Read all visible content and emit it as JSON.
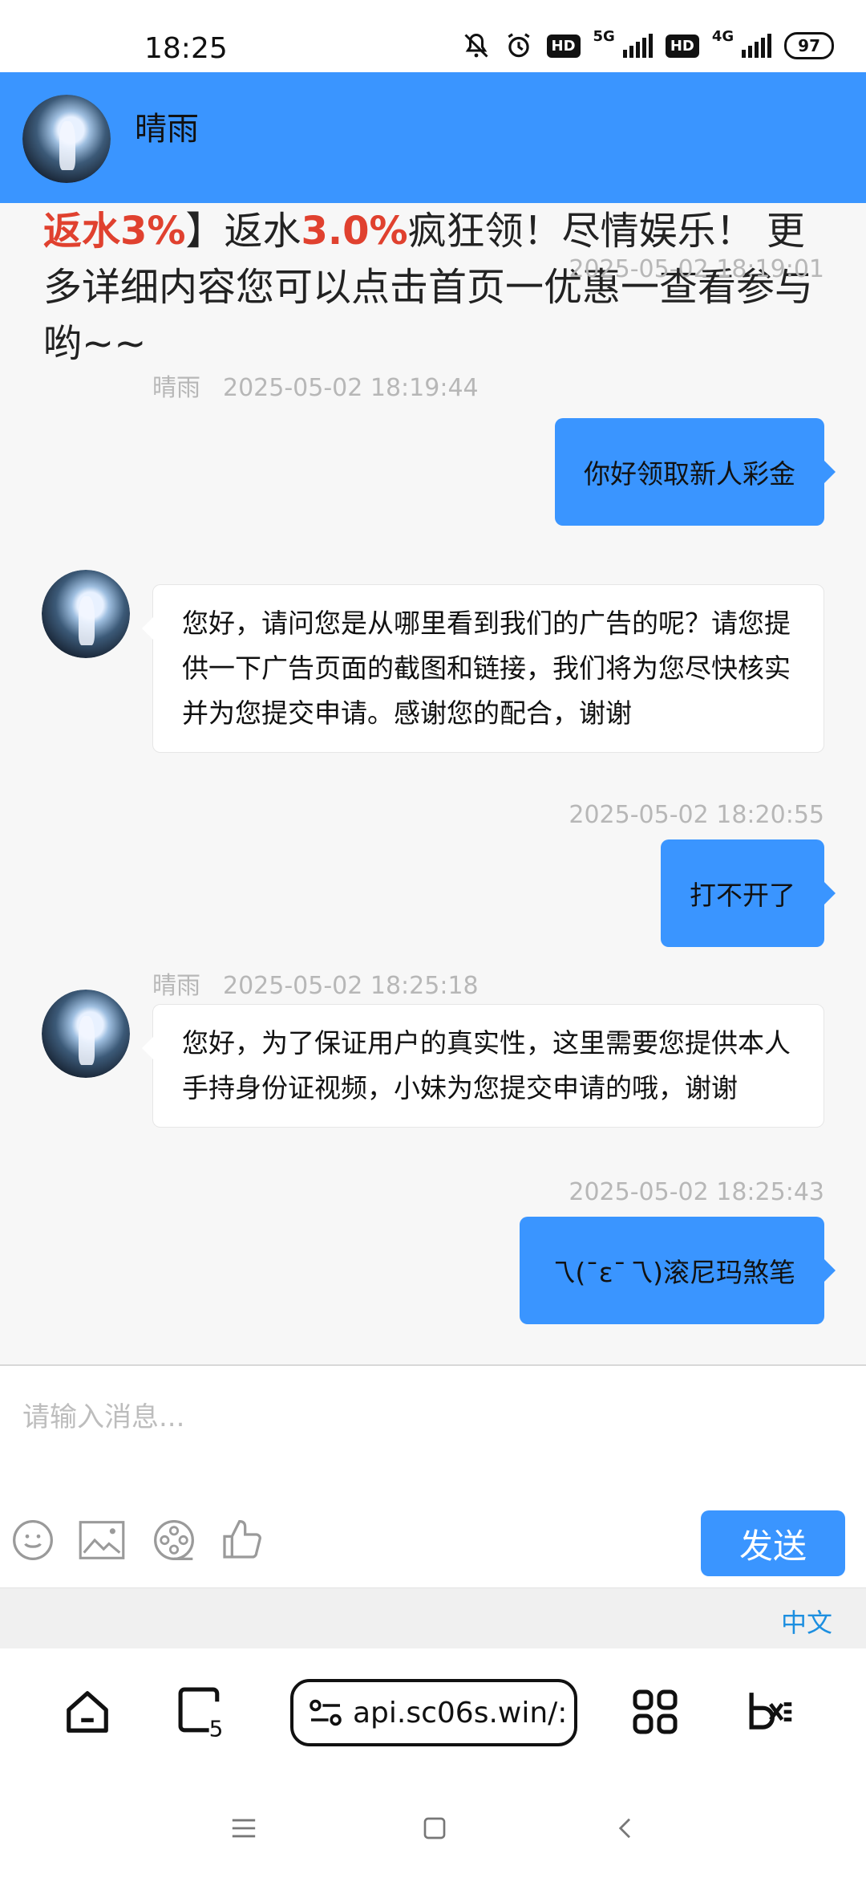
{
  "status": {
    "time": "18:25",
    "hd1": "HD",
    "net1": "5G",
    "hd2": "HD",
    "net2": "4G",
    "battery": "97"
  },
  "header": {
    "title": "晴雨"
  },
  "chat": {
    "prev_text": {
      "red1": "返水3%",
      "plain1": "】返水",
      "red2": "3.0%",
      "plain2": "疯狂领！尽情娱乐！ 更多详细内容您可以点击首页一优惠一查看参与哟~~"
    },
    "messages": [
      {
        "side": "out",
        "time": "2025-05-02 18:19:01",
        "text": "你好领取新人彩金"
      },
      {
        "side": "in",
        "sender": "晴雨",
        "time": "2025-05-02 18:19:44",
        "text": "您好，请问您是从哪里看到我们的广告的呢？请您提供一下广告页面的截图和链接，我们将为您尽快核实并为您提交申请。感谢您的配合，谢谢"
      },
      {
        "side": "out",
        "time": "2025-05-02 18:20:55",
        "text": "打不开了"
      },
      {
        "side": "in",
        "sender": "晴雨",
        "time": "2025-05-02 18:25:18",
        "text": "您好，为了保证用户的真实性，这里需要您提供本人手持身份证视频，小妹为您提交申请的哦，谢谢"
      },
      {
        "side": "out",
        "time": "2025-05-02 18:25:43",
        "text": "乁(ˉεˉ乁)滚尼玛煞笔"
      }
    ]
  },
  "input": {
    "placeholder": "请输入消息...",
    "send_label": "发送",
    "tools": [
      "emoji-icon",
      "image-icon",
      "film-reel-icon",
      "thumbs-up-icon"
    ]
  },
  "lang": {
    "label": "中文"
  },
  "browser": {
    "tab_count": "5",
    "url": "api.sc06s.win/:"
  },
  "colors": {
    "accent": "#3a95ff",
    "highlight_red": "#e0412f",
    "link_blue": "#1d8fe0"
  }
}
